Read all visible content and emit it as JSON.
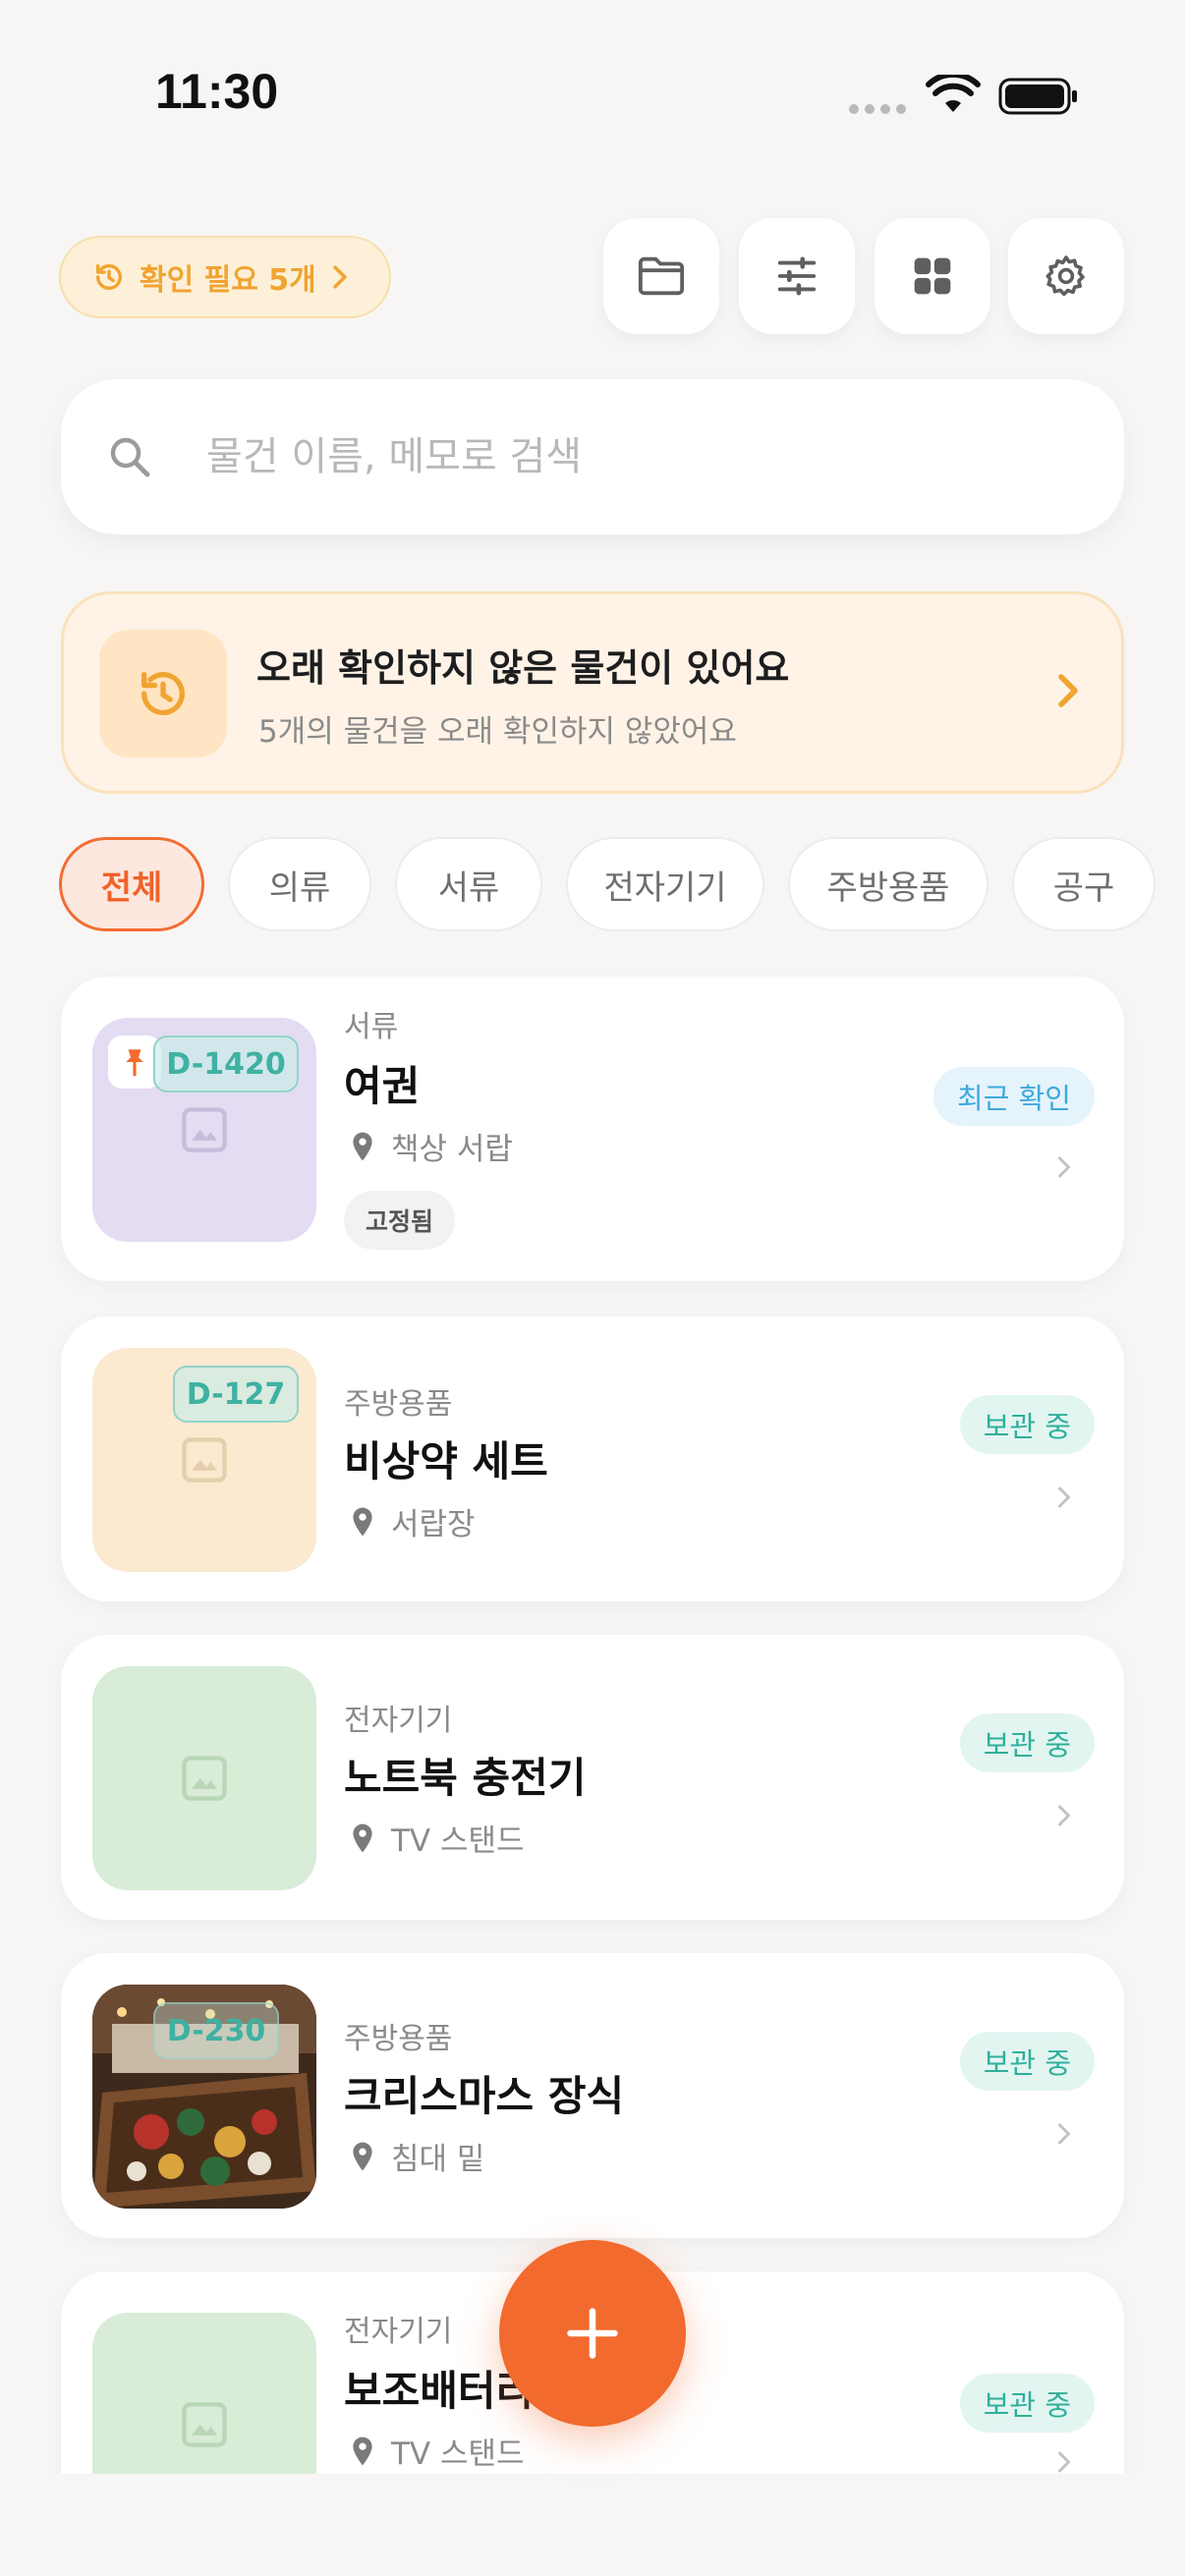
{
  "status_bar": {
    "time": "11:30"
  },
  "header": {
    "review_pill_label": "확인 필요 5개",
    "buttons": [
      "folder-icon",
      "sliders-icon",
      "grid-icon",
      "gear-icon"
    ]
  },
  "search": {
    "placeholder": "물건 이름, 메모로 검색"
  },
  "banner": {
    "title": "오래 확인하지 않은 물건이 있어요",
    "subtitle": "5개의 물건을 오래 확인하지 않았어요"
  },
  "categories": [
    {
      "label": "전체",
      "active": true
    },
    {
      "label": "의류"
    },
    {
      "label": "서류"
    },
    {
      "label": "전자기기"
    },
    {
      "label": "주방용품"
    },
    {
      "label": "공구"
    }
  ],
  "items": [
    {
      "category": "서류",
      "name": "여권",
      "location": "책상 서랍",
      "tag": "고정됨",
      "code": "D-1420",
      "status": "최근 확인",
      "thumb_color": "#e3dcf3",
      "pinned": true
    },
    {
      "category": "주방용품",
      "name": "비상약 세트",
      "location": "서랍장",
      "code": "D-127",
      "status": "보관 중",
      "thumb_color": "#fbe9d0"
    },
    {
      "category": "전자기기",
      "name": "노트북 충전기",
      "location": "TV 스탠드",
      "status": "보관 중",
      "thumb_color": "#d8ecd7"
    },
    {
      "category": "주방용품",
      "name": "크리스마스 장식",
      "location": "침대 밑",
      "code": "D-230",
      "status": "보관 중",
      "thumb_photo": true
    },
    {
      "category": "전자기기",
      "name": "보조배터리",
      "location": "TV 스탠드",
      "status": "보관 중",
      "thumb_color": "#d8ecd7"
    }
  ],
  "colors": {
    "accent": "#f26a2e",
    "warning": "#f0a431",
    "teal": "#2faf9b"
  }
}
